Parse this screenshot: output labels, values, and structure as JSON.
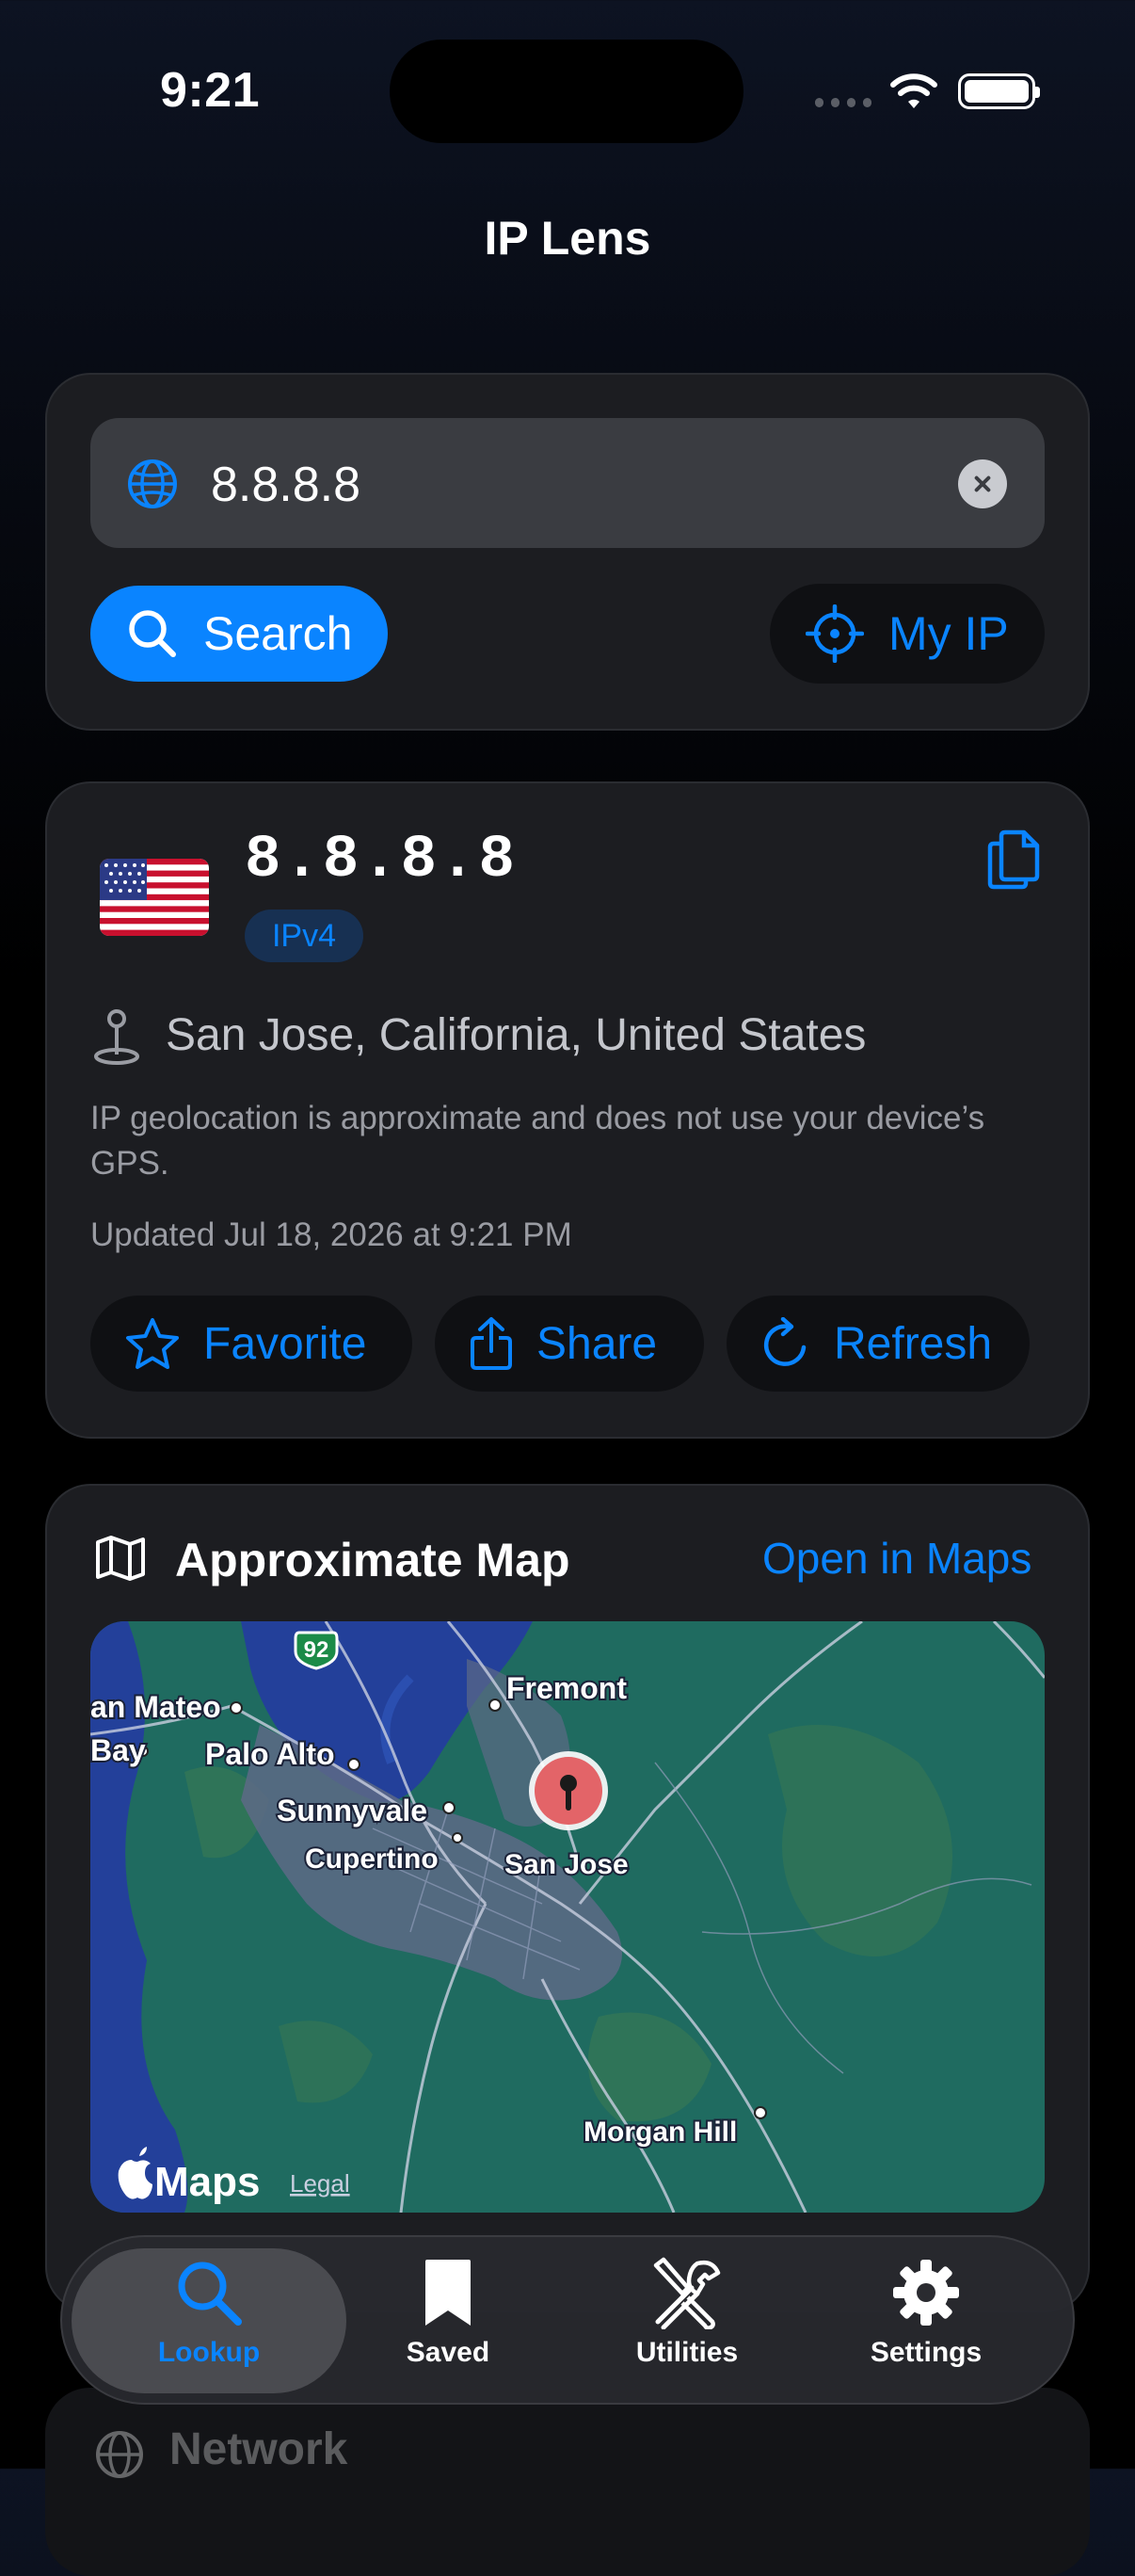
{
  "status_bar": {
    "time": "9:21"
  },
  "app": {
    "title": "IP Lens"
  },
  "search": {
    "query": "8.8.8.8",
    "search_label": "Search",
    "my_ip_label": "My IP"
  },
  "result": {
    "ip": "8.8.8.8",
    "version_badge": "IPv4",
    "location": "San Jose, California, United States",
    "note": "IP geolocation is approximate and does not use your device’s GPS.",
    "updated": "Updated Jul 18, 2026 at 9:21 PM",
    "actions": {
      "favorite": "Favorite",
      "share": "Share",
      "refresh": "Refresh"
    }
  },
  "map": {
    "title": "Approximate Map",
    "open_label": "Open in Maps",
    "places": {
      "fremont": "Fremont",
      "san_mateo": "an Mateo",
      "bay": "Bay",
      "palo_alto": "Palo Alto",
      "sunnyvale": "Sunnyvale",
      "cupertino": "Cupertino",
      "san_jose": "San Jose",
      "morgan_hill": "Morgan Hill"
    },
    "highway": "92",
    "attribution": "Maps",
    "legal": "Legal",
    "colors": {
      "land": "#1f6b60",
      "water": "#23409a",
      "urban": "#5d6a86"
    }
  },
  "next_section": {
    "label": "Network"
  },
  "tabs": [
    {
      "label": "Lookup",
      "icon": "magnifier-icon",
      "active": true
    },
    {
      "label": "Saved",
      "icon": "bookmark-icon",
      "active": false
    },
    {
      "label": "Utilities",
      "icon": "tools-icon",
      "active": false
    },
    {
      "label": "Settings",
      "icon": "gear-icon",
      "active": false
    }
  ],
  "theme": {
    "accent": "#0a84ff",
    "card": "#1c1d21"
  }
}
